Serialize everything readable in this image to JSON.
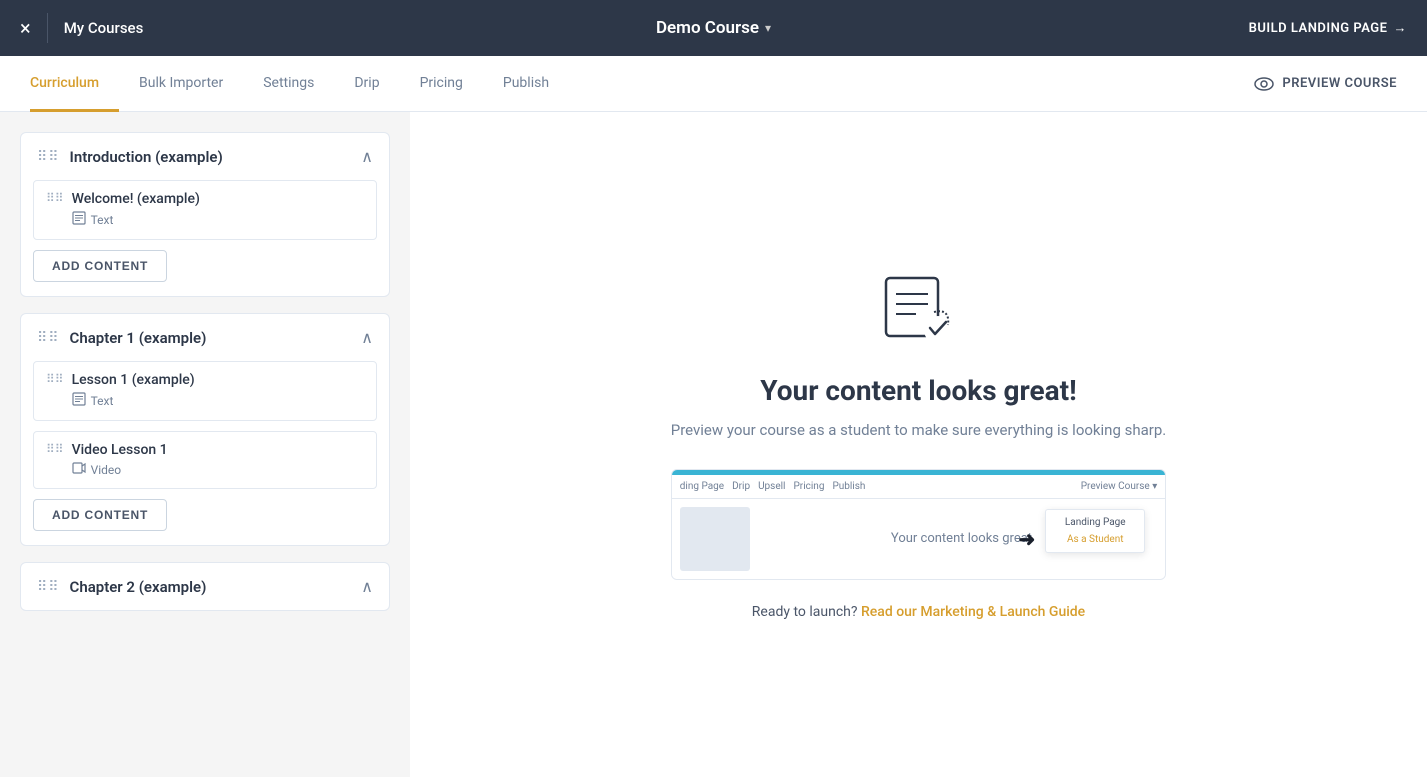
{
  "topNav": {
    "closeLabel": "×",
    "myCoursesLabel": "My Courses",
    "courseTitle": "Demo Course",
    "buildLandingLabel": "BUILD LANDING PAGE",
    "arrowRight": "→"
  },
  "tabs": {
    "items": [
      {
        "label": "Curriculum",
        "active": true
      },
      {
        "label": "Bulk Importer",
        "active": false
      },
      {
        "label": "Settings",
        "active": false
      },
      {
        "label": "Drip",
        "active": false
      },
      {
        "label": "Pricing",
        "active": false
      },
      {
        "label": "Publish",
        "active": false
      }
    ],
    "previewCourseLabel": "PREVIEW COURSE"
  },
  "sidebar": {
    "sections": [
      {
        "title": "Introduction (example)",
        "lessons": [
          {
            "name": "Welcome! (example)",
            "type": "Text",
            "typeIcon": "📄"
          }
        ],
        "addContentLabel": "ADD CONTENT"
      },
      {
        "title": "Chapter 1 (example)",
        "lessons": [
          {
            "name": "Lesson 1 (example)",
            "type": "Text",
            "typeIcon": "📄"
          },
          {
            "name": "Video Lesson 1",
            "type": "Video",
            "typeIcon": "🎬"
          }
        ],
        "addContentLabel": "ADD CONTENT"
      },
      {
        "title": "Chapter 2 (example)",
        "lessons": [],
        "addContentLabel": ""
      }
    ]
  },
  "mainContent": {
    "title": "Your content looks great!",
    "subtitle": "Preview your course as a student to make sure everything is looking sharp.",
    "launchText": "Ready to launch?",
    "launchLinkLabel": "Read our Marketing & Launch Guide",
    "screenshotTabs": [
      "ding Page",
      "Drip",
      "Upsell",
      "Pricing",
      "Publish"
    ],
    "screenshotPreviewLabel": "Preview Course ▾",
    "screenshotDropdownItems": [
      "Landing Page",
      "As a Student"
    ],
    "screenshotBodyText": "Your content looks great"
  },
  "icons": {
    "drag": "⠿",
    "collapse": "∧",
    "text": "📄",
    "video": "📹"
  }
}
